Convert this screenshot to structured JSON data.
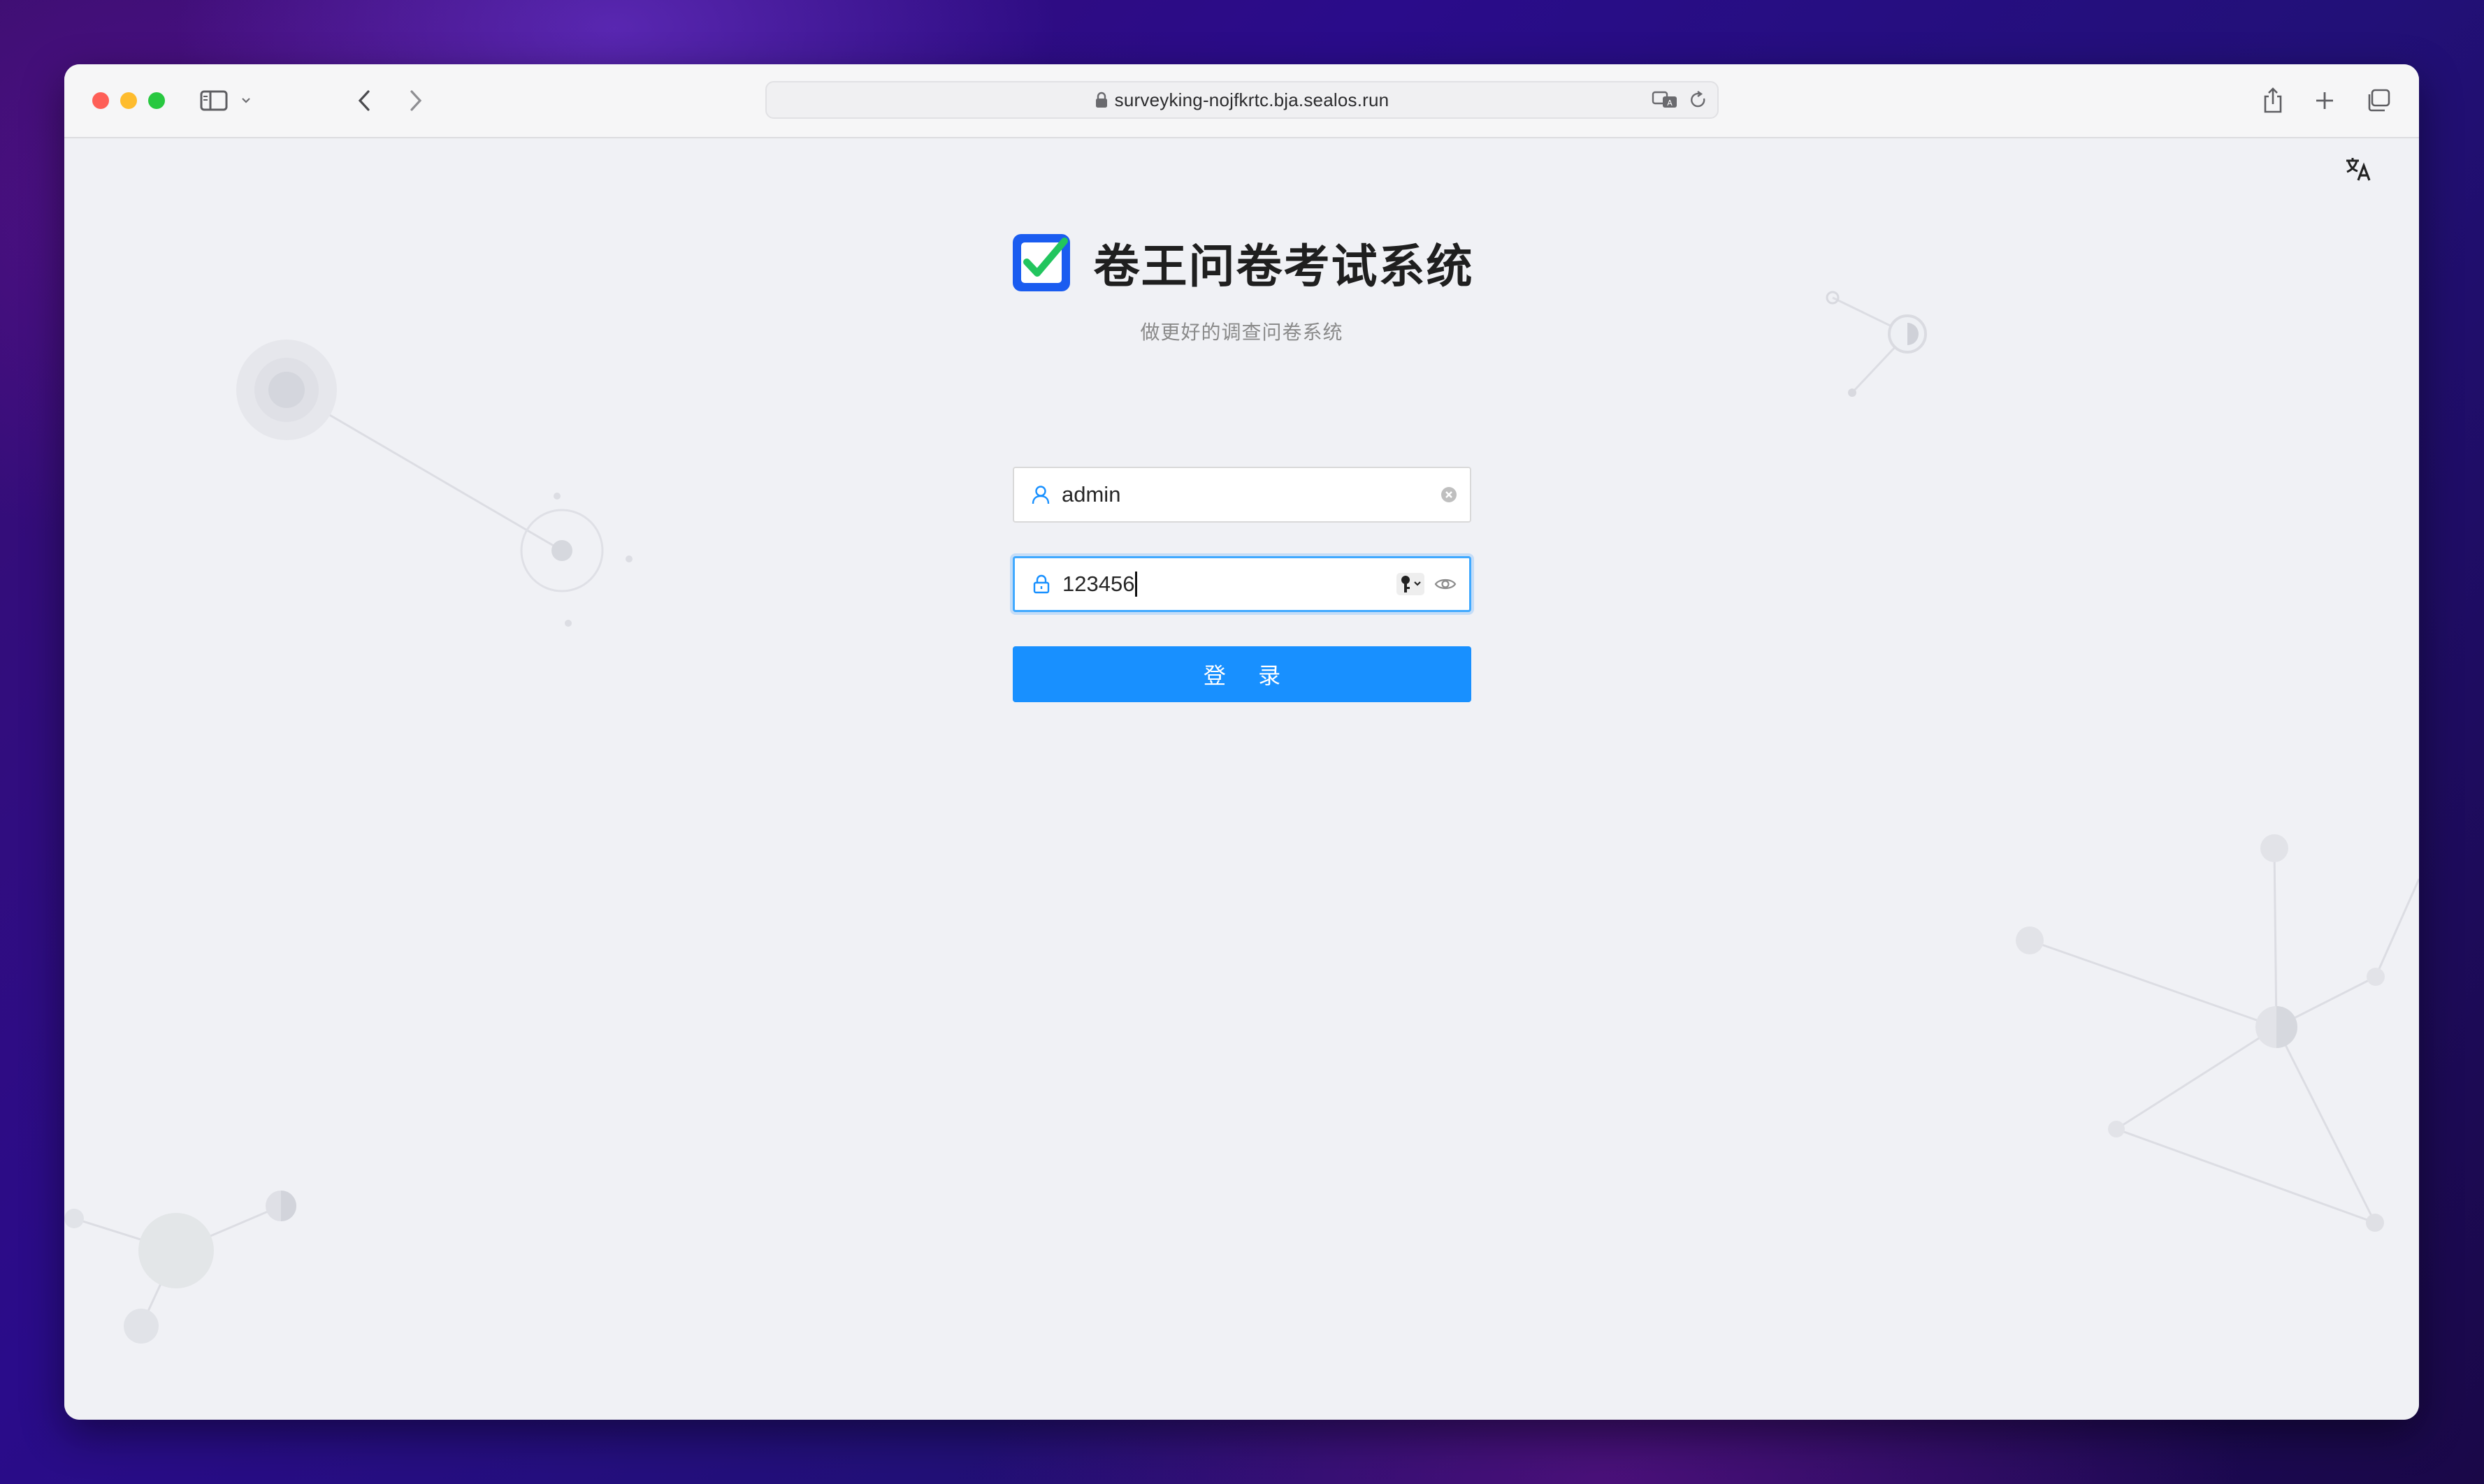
{
  "browser": {
    "url": "surveyking-nojfkrtc.bja.sealos.run"
  },
  "page": {
    "brand_title": "卷王问卷考试系统",
    "subtitle": "做更好的调查问卷系统",
    "login_label": "登 录"
  },
  "form": {
    "username": {
      "value": "admin",
      "icon": "user-icon"
    },
    "password": {
      "value": "123456",
      "icon": "lock-icon"
    }
  },
  "colors": {
    "primary": "#1890ff",
    "focus_border": "#40a9ff",
    "logo_blue": "#1a5cf0",
    "logo_check": "#22c55e",
    "page_bg": "#f0f1f5"
  }
}
